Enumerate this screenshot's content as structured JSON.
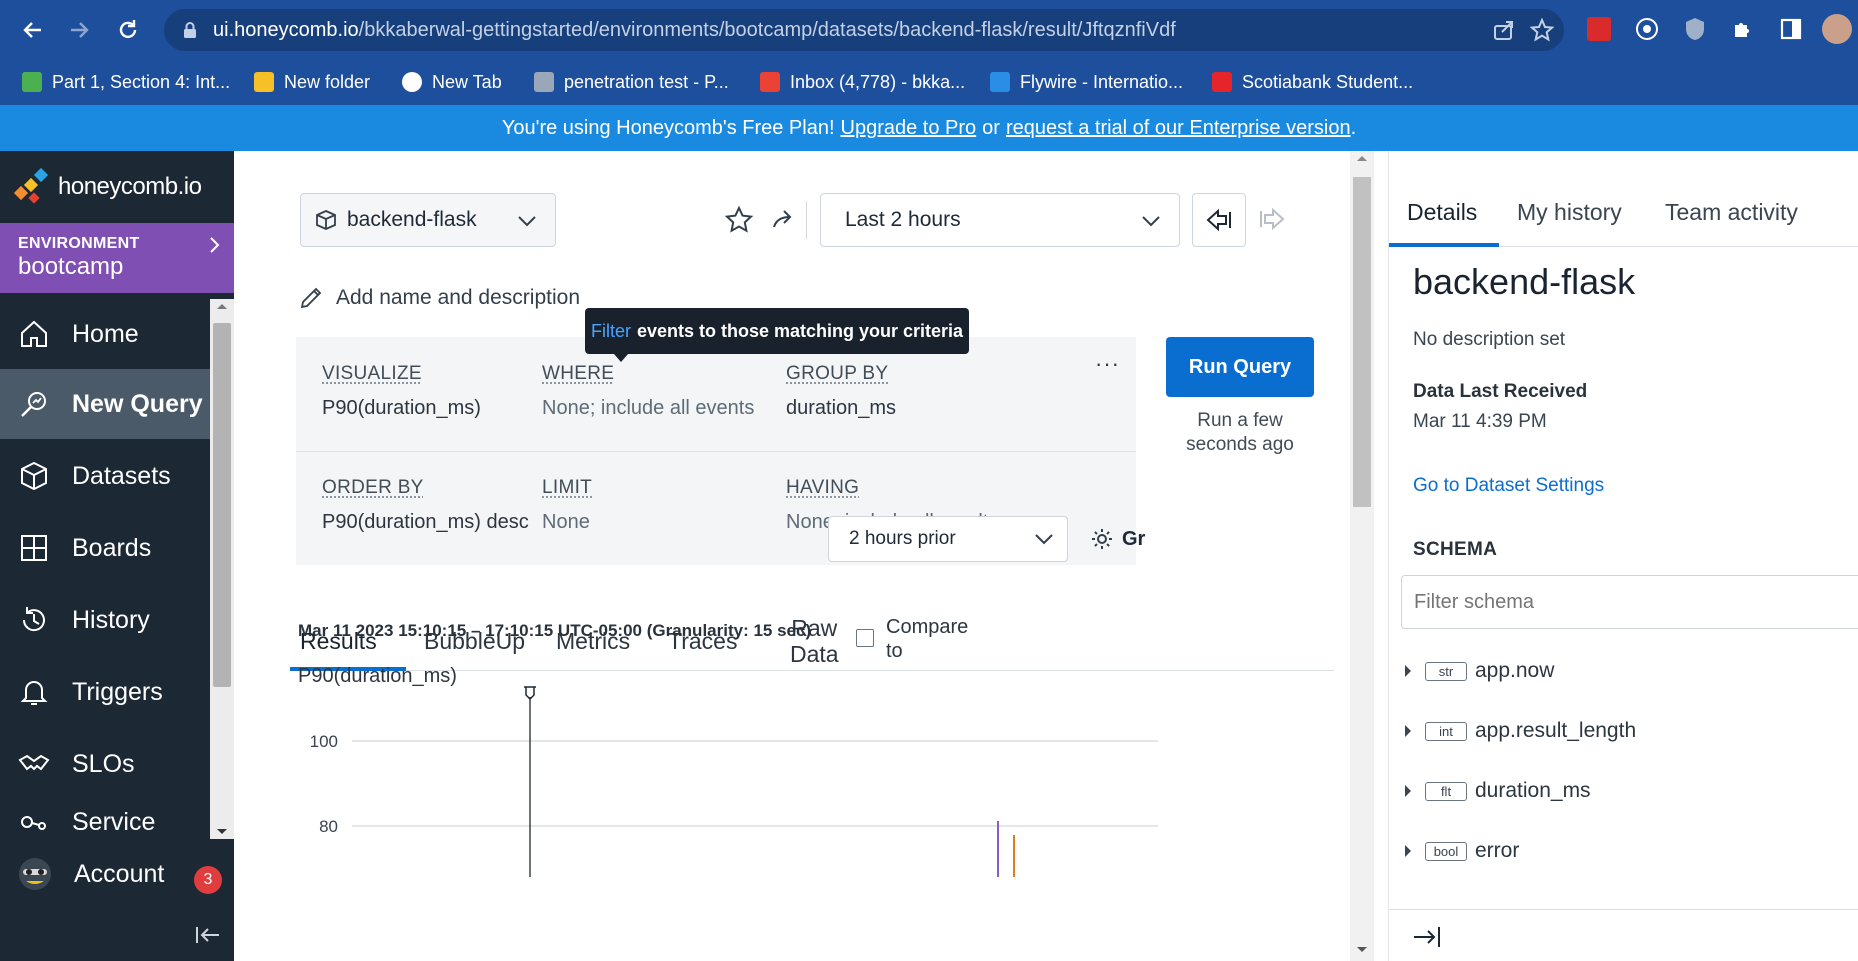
{
  "browser": {
    "url_host": "ui.honeycomb.io",
    "url_path": "/bkkaberwal-gettingstarted/environments/bootcamp/datasets/backend-flask/result/JftqznfiVdf",
    "bookmarks": [
      {
        "label": "Part 1, Section 4: Int...",
        "color": "#4caf50"
      },
      {
        "label": "New folder",
        "color": "#f6c026"
      },
      {
        "label": "New Tab",
        "color": "#ffffff"
      },
      {
        "label": "penetration test - P...",
        "color": "#9aa7b8"
      },
      {
        "label": "Inbox (4,778) - bkka...",
        "color": "#ea4335"
      },
      {
        "label": "Flywire - Internatio...",
        "color": "#2a8de6"
      },
      {
        "label": "Scotiabank Student...",
        "color": "#e5252a"
      }
    ]
  },
  "banner": {
    "prefix": "You're using Honeycomb's Free Plan!",
    "upgrade_link": "Upgrade to Pro",
    "middle": "or",
    "trial_link": "request a trial of our Enterprise version",
    "suffix": "."
  },
  "sidebar": {
    "logo": "honeycomb.io",
    "env_label": "ENVIRONMENT",
    "env_name": "bootcamp",
    "items": [
      {
        "label": "Home",
        "icon": "home-icon"
      },
      {
        "label": "New Query",
        "icon": "new-query-icon",
        "active": true
      },
      {
        "label": "Datasets",
        "icon": "datasets-icon"
      },
      {
        "label": "Boards",
        "icon": "boards-icon"
      },
      {
        "label": "History",
        "icon": "history-icon"
      },
      {
        "label": "Triggers",
        "icon": "bell-icon"
      },
      {
        "label": "SLOs",
        "icon": "handshake-icon"
      },
      {
        "label": "Service",
        "icon": "service-icon"
      }
    ],
    "account_label": "Account",
    "account_badge": "3"
  },
  "query": {
    "dataset": "backend-flask",
    "time_range": "Last 2 hours",
    "add_name": "Add name and description",
    "tooltip_highlight": "Filter",
    "tooltip_text": "events to those matching your criteria",
    "clauses": {
      "visualize": {
        "label": "VISUALIZE",
        "value": "P90(duration_ms)"
      },
      "where": {
        "label": "WHERE",
        "value": "None; include all events"
      },
      "group_by": {
        "label": "GROUP BY",
        "value": "duration_ms"
      },
      "order_by": {
        "label": "ORDER BY",
        "value": "P90(duration_ms) desc"
      },
      "limit": {
        "label": "LIMIT",
        "value": "None"
      },
      "having": {
        "label": "HAVING",
        "value": "None; include all results"
      }
    },
    "more_label": "···",
    "run_label": "Run Query",
    "run_note": "Run a few seconds ago"
  },
  "results": {
    "tabs": [
      "Results",
      "BubbleUp",
      "Metrics",
      "Traces"
    ],
    "raw_data_line1": "Raw",
    "raw_data_line2": "Data",
    "compare_line1": "Compare",
    "compare_line2": "to",
    "compare_value": "2 hours prior",
    "gear_label": "Gr",
    "range_text": "Mar 11 2023 15:10:15 – 17:10:15 UTC-05:00 (Granularity: 15 sec)",
    "metric_label": "P90(duration_ms)",
    "y_ticks": [
      "100",
      "80"
    ],
    "series_colors": [
      "#8a5cc9",
      "#e07b1e"
    ]
  },
  "details": {
    "tabs": [
      "Details",
      "My history",
      "Team activity"
    ],
    "title": "backend-flask",
    "description": "No description set",
    "data_last_received_label": "Data Last Received",
    "data_last_received_value": "Mar 11 4:39 PM",
    "settings_link": "Go to Dataset Settings",
    "schema_heading": "SCHEMA",
    "schema_placeholder": "Filter schema",
    "schema": [
      {
        "type": "str",
        "name": "app.now"
      },
      {
        "type": "int",
        "name": "app.result_length"
      },
      {
        "type": "flt",
        "name": "duration_ms"
      },
      {
        "type": "bool",
        "name": "error"
      }
    ]
  }
}
